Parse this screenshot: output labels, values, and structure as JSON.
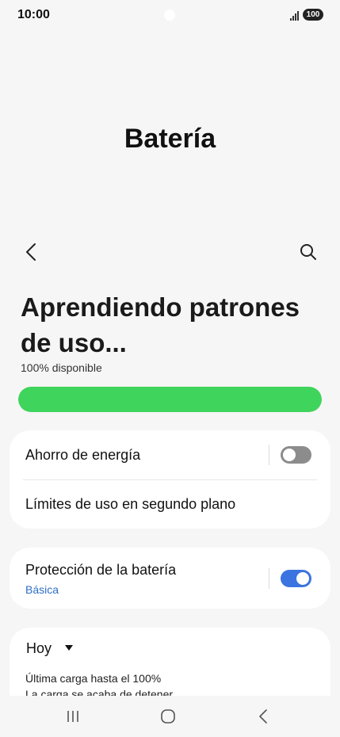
{
  "status_bar": {
    "time": "10:00",
    "battery_level": "100",
    "icons": [
      "camera-dot",
      "signal-icon",
      "battery-icon"
    ]
  },
  "header": {
    "title": "Batería"
  },
  "toolbar": {
    "back_icon": "chevron-left-icon",
    "search_icon": "search-icon"
  },
  "battery_status": {
    "heading": "Aprendiendo patrones de uso...",
    "available": "100% disponible",
    "level_percent": 100,
    "bar_color": "#3fd45c"
  },
  "settings": {
    "power_saving": {
      "label": "Ahorro de energía",
      "enabled": false
    },
    "background_limits": {
      "label": "Límites de uso en segundo plano"
    },
    "battery_protection": {
      "label": "Protección de la batería",
      "value": "Básica",
      "enabled": true
    }
  },
  "usage": {
    "period": "Hoy",
    "last_charge": "Última carga hasta el 100%",
    "charge_status": "La carga se acaba de detener"
  },
  "colors": {
    "accent": "#3b74e0",
    "link_text": "#2f6ec7",
    "toggle_off": "#8c8c8c"
  },
  "nav_bar": {
    "icons": [
      "recent-apps-icon",
      "home-icon",
      "back-icon"
    ]
  }
}
